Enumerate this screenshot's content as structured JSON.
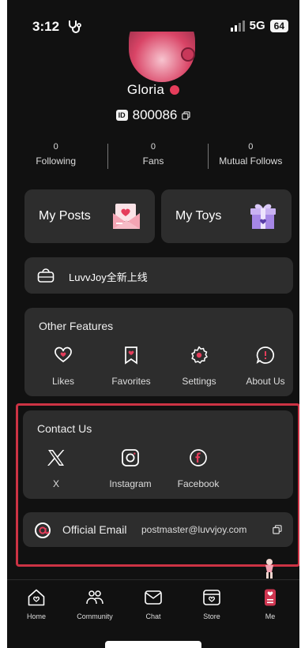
{
  "status_bar": {
    "time": "3:12",
    "network": "5G",
    "battery": "64"
  },
  "profile": {
    "name": "Gloria",
    "id_tag": "ID",
    "id_number": "800086"
  },
  "stats": [
    {
      "count": "0",
      "label": "Following"
    },
    {
      "count": "0",
      "label": "Fans"
    },
    {
      "count": "0",
      "label": "Mutual Follows"
    }
  ],
  "cards": {
    "my_posts": "My Posts",
    "my_toys": "My Toys"
  },
  "banner": {
    "text": "LuvvJoy全新上线"
  },
  "other_features": {
    "title": "Other Features",
    "items": [
      {
        "label": "Likes",
        "icon": "heart-icon"
      },
      {
        "label": "Favorites",
        "icon": "bookmark-icon"
      },
      {
        "label": "Settings",
        "icon": "gear-icon"
      },
      {
        "label": "About Us",
        "icon": "chat-bubble-icon"
      }
    ]
  },
  "contact_us": {
    "title": "Contact Us",
    "items": [
      {
        "label": "X",
        "icon": "x-logo-icon"
      },
      {
        "label": "Instagram",
        "icon": "instagram-icon"
      },
      {
        "label": "Facebook",
        "icon": "facebook-icon"
      }
    ]
  },
  "email": {
    "label": "Official Email",
    "value": "postmaster@luvvjoy.com"
  },
  "tabs": [
    {
      "label": "Home",
      "icon": "home-icon"
    },
    {
      "label": "Community",
      "icon": "community-icon"
    },
    {
      "label": "Chat",
      "icon": "chat-icon"
    },
    {
      "label": "Store",
      "icon": "store-icon"
    },
    {
      "label": "Me",
      "icon": "me-icon",
      "active": true
    }
  ],
  "colors": {
    "background": "#111111",
    "card": "#2d2d2d",
    "accent": "#e53d5b",
    "highlight_border": "#cc3344"
  }
}
